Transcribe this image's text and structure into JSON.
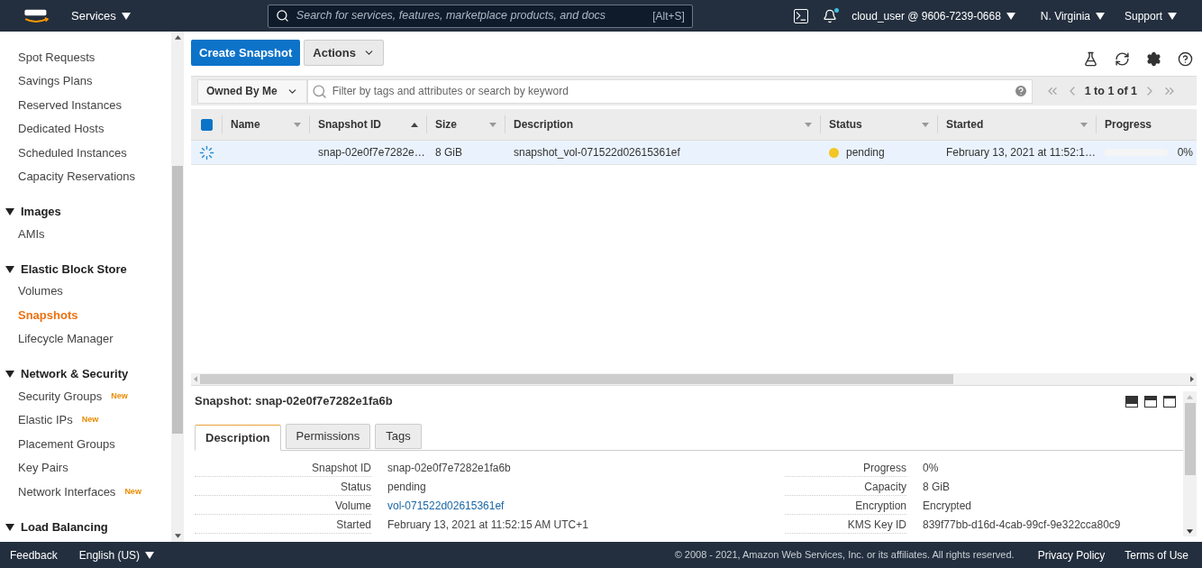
{
  "top_nav": {
    "services": "Services",
    "search": {
      "placeholder": "Search for services, features, marketplace products, and docs",
      "shortcut": "[Alt+S]"
    },
    "account": "cloud_user @ 9606-7239-0668",
    "region": "N. Virginia",
    "support": "Support",
    "notification_dot": true
  },
  "sidebar": {
    "sections": [
      {
        "items": [
          {
            "label": "Spot Requests",
            "selected": false
          },
          {
            "label": "Savings Plans",
            "selected": false
          },
          {
            "label": "Reserved Instances",
            "selected": false
          },
          {
            "label": "Dedicated Hosts",
            "selected": false
          },
          {
            "label": "Scheduled Instances",
            "selected": false
          },
          {
            "label": "Capacity Reservations",
            "selected": false
          }
        ]
      },
      {
        "title": "Images",
        "expanded": true,
        "items": [
          {
            "label": "AMIs",
            "selected": false
          }
        ]
      },
      {
        "title": "Elastic Block Store",
        "expanded": true,
        "items": [
          {
            "label": "Volumes",
            "selected": false
          },
          {
            "label": "Snapshots",
            "selected": true
          },
          {
            "label": "Lifecycle Manager",
            "selected": false
          }
        ]
      },
      {
        "title": "Network & Security",
        "expanded": true,
        "items": [
          {
            "label": "Security Groups",
            "selected": false,
            "badge": "New"
          },
          {
            "label": "Elastic IPs",
            "selected": false,
            "badge": "New"
          },
          {
            "label": "Placement Groups",
            "selected": false
          },
          {
            "label": "Key Pairs",
            "selected": false
          },
          {
            "label": "Network Interfaces",
            "selected": false,
            "badge": "New"
          }
        ]
      },
      {
        "title": "Load Balancing",
        "expanded": true
      }
    ]
  },
  "toolbar": {
    "primary": "Create Snapshot",
    "actions": "Actions"
  },
  "filter": {
    "owner": "Owned By Me",
    "placeholder": "Filter by tags and attributes or search by keyword",
    "pagination": "1 to 1 of 1"
  },
  "table": {
    "header_checked": true,
    "columns": [
      {
        "label": "Name",
        "kind": "sortable",
        "sorted": false
      },
      {
        "label": "Snapshot ID",
        "kind": "sortable",
        "sorted": true
      },
      {
        "label": "Size",
        "kind": "sortable",
        "sorted": false
      },
      {
        "label": "Description",
        "kind": "sortable",
        "sorted": false
      },
      {
        "label": "Status",
        "kind": "sortable",
        "sorted": false
      },
      {
        "label": "Started",
        "kind": "sortable",
        "sorted": false
      },
      {
        "label": "Progress",
        "kind": "plain"
      }
    ],
    "rows": [
      {
        "selected": true,
        "snapshot_id": "snap-02e0f7e7282e…",
        "size": "8 GiB",
        "description": "snapshot_vol-071522d02615361ef",
        "status": "pending",
        "started": "February 13, 2021 at 11:52:1…",
        "progress": {
          "level": 0,
          "reading": "0%"
        }
      }
    ]
  },
  "detail": {
    "title": "Snapshot: snap-02e0f7e7282e1fa6b",
    "tabs": [
      {
        "label": "Description",
        "selected": true
      },
      {
        "label": "Permissions",
        "selected": false
      },
      {
        "label": "Tags",
        "selected": false
      }
    ],
    "left_fields": [
      {
        "label": "Snapshot ID",
        "value": "snap-02e0f7e7282e1fa6b",
        "kind": "text"
      },
      {
        "label": "Status",
        "value": "pending",
        "kind": "text"
      },
      {
        "label": "Volume",
        "value": "vol-071522d02615361ef",
        "kind": "link"
      },
      {
        "label": "Started",
        "value": "February 13, 2021 at 11:52:15 AM UTC+1",
        "kind": "text"
      }
    ],
    "right_fields": [
      {
        "label": "Progress",
        "value": "0%",
        "kind": "text"
      },
      {
        "label": "Capacity",
        "value": "8 GiB",
        "kind": "text"
      },
      {
        "label": "Encryption",
        "value": "Encrypted",
        "kind": "text"
      },
      {
        "label": "KMS Key ID",
        "value": "839f77bb-d16d-4cab-99cf-9e322cca80c9",
        "kind": "text"
      }
    ]
  },
  "footer": {
    "feedback": "Feedback",
    "language": "English (US)",
    "copyright": "© 2008 - 2021, Amazon Web Services, Inc. or its affiliates. All rights reserved.",
    "links": [
      "Privacy Policy",
      "Terms of Use"
    ]
  }
}
